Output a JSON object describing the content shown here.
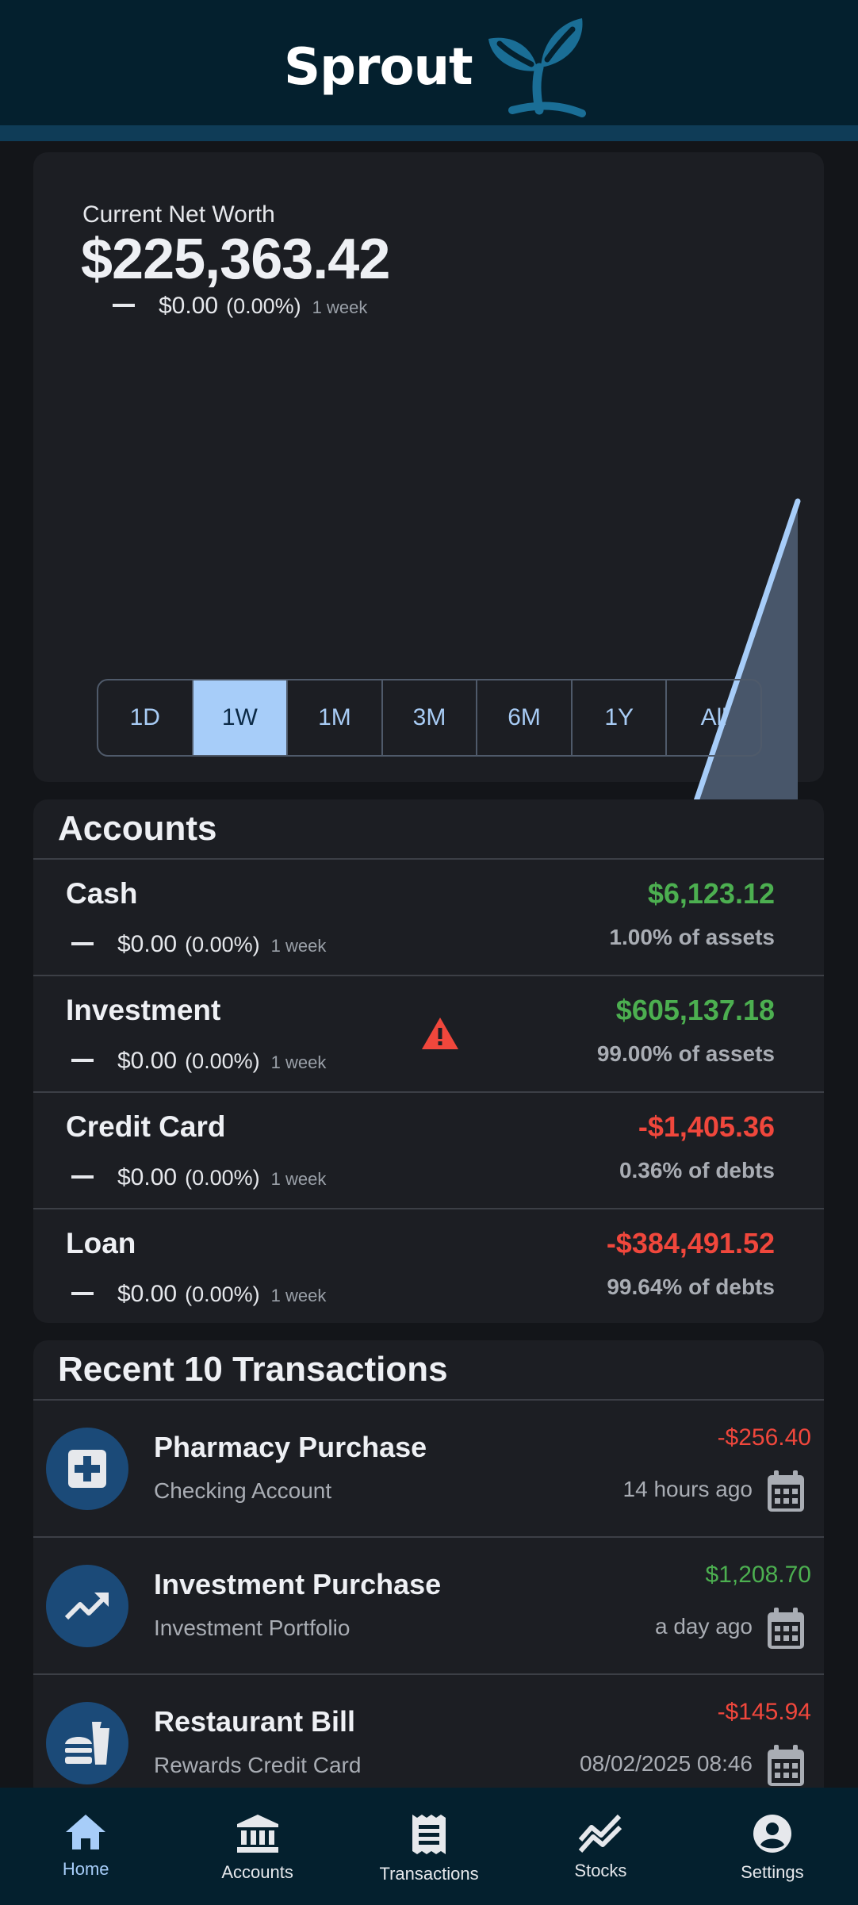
{
  "app": {
    "name": "Sprout"
  },
  "net_worth": {
    "label": "Current Net Worth",
    "value": "$225,363.42",
    "change_amount": "$0.00",
    "change_percent": "(0.00%)",
    "change_period": "1 week"
  },
  "chart_data": {
    "type": "area",
    "series": [
      {
        "values": [
          0,
          0,
          0,
          0,
          0,
          0,
          0,
          1
        ]
      }
    ],
    "grid": false,
    "line_color": "#a7cdf9",
    "fill_color": "#48566a"
  },
  "ranges": {
    "items": [
      "1D",
      "1W",
      "1M",
      "3M",
      "6M",
      "1Y",
      "All"
    ],
    "selected": "1W"
  },
  "accounts": {
    "title": "Accounts",
    "rows": [
      {
        "name": "Cash",
        "amount": "$6,123.12",
        "share": "1.00% of assets",
        "change_amount": "$0.00",
        "change_percent": "(0.00%)",
        "change_period": "1 week",
        "amount_color": "#4caf50"
      },
      {
        "name": "Investment",
        "amount": "$605,137.18",
        "share": "99.00% of assets",
        "change_amount": "$0.00",
        "change_percent": "(0.00%)",
        "change_period": "1 week",
        "amount_color": "#4caf50",
        "warning_icon": "warning-triangle-icon"
      },
      {
        "name": "Credit Card",
        "amount": "-$1,405.36",
        "share": "0.36% of debts",
        "change_amount": "$0.00",
        "change_percent": "(0.00%)",
        "change_period": "1 week",
        "amount_color": "#f0473c"
      },
      {
        "name": "Loan",
        "amount": "-$384,491.52",
        "share": "99.64% of debts",
        "change_amount": "$0.00",
        "change_percent": "(0.00%)",
        "change_period": "1 week",
        "amount_color": "#f0473c"
      }
    ]
  },
  "transactions": {
    "title": "Recent 10 Transactions",
    "rows": [
      {
        "title": "Pharmacy Purchase",
        "account": "Checking Account",
        "amount": "-$256.40",
        "date": "14 hours ago",
        "icon": "medical-plus-icon",
        "amount_color": "#f0473c"
      },
      {
        "title": "Investment Purchase",
        "account": "Investment Portfolio",
        "amount": "$1,208.70",
        "date": "a day ago",
        "icon": "trending-up-icon",
        "amount_color": "#4caf50"
      },
      {
        "title": "Restaurant Bill",
        "account": "Rewards Credit Card",
        "amount": "-$145.94",
        "date": "08/02/2025 08:46",
        "icon": "fastfood-icon",
        "amount_color": "#f0473c"
      }
    ]
  },
  "nav": {
    "items": [
      {
        "label": "Home",
        "icon": "home-icon",
        "active": true
      },
      {
        "label": "Accounts",
        "icon": "bank-icon",
        "active": false
      },
      {
        "label": "Transactions",
        "icon": "receipt-icon",
        "active": false
      },
      {
        "label": "Stocks",
        "icon": "stocks-chart-icon",
        "active": false
      },
      {
        "label": "Settings",
        "icon": "account-circle-icon",
        "active": false
      }
    ]
  },
  "colors": {
    "header_bg": "#04202e",
    "card_bg": "#1c1e23",
    "accent": "#a7cdf9",
    "positive": "#4caf50",
    "negative": "#f0473c"
  }
}
